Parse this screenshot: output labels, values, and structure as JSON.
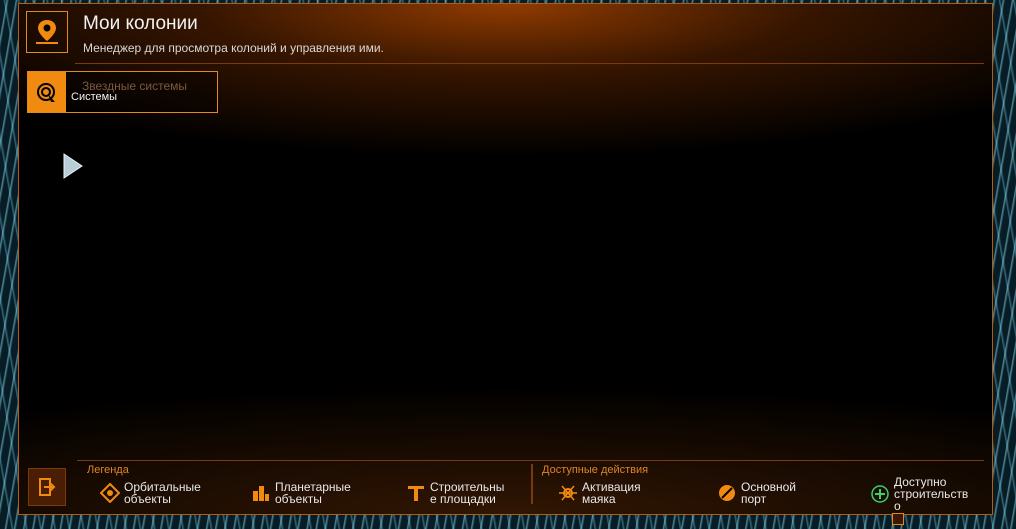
{
  "header": {
    "title": "Мои колонии",
    "subtitle": "Менеджер для просмотра колоний и управления ими.",
    "icon": "location-pin-icon"
  },
  "tab": {
    "ghost_label": "Звездные системы",
    "label": "Системы",
    "icon": "radar-icon"
  },
  "footer": {
    "legend_title": "Легенда",
    "actions_title": "Доступные действия",
    "legend_items": [
      {
        "label": "Орбитальные\nобъекты",
        "icon": "orbital-icon"
      },
      {
        "label": "Планетарные\nобъекты",
        "icon": "planetary-icon"
      },
      {
        "label": "Строительны\nе площадки",
        "icon": "construction-site-icon"
      }
    ],
    "action_items": [
      {
        "label": "Активация\nмаяка",
        "icon": "beacon-icon"
      },
      {
        "label": "Основной\nпорт",
        "icon": "main-port-icon"
      },
      {
        "label": "Доступно\nстроительств\nо",
        "icon": "add-construction-icon"
      }
    ],
    "exit_icon": "exit-icon"
  },
  "colors": {
    "accent": "#f08a10",
    "border": "#e08a20",
    "text": "#f2f2f2"
  }
}
